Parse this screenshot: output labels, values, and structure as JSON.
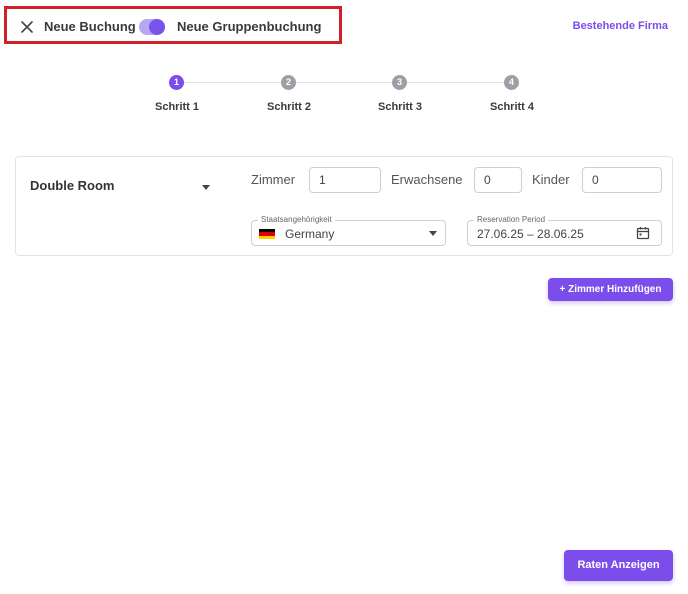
{
  "header": {
    "close_icon": "close-icon",
    "left_label": "Neue Buchung",
    "right_label": "Neue Gruppenbuchung",
    "toggle_on": true,
    "existing_company_link": "Bestehende Firma",
    "highlight_color": "#d0202a"
  },
  "stepper": {
    "steps": [
      {
        "number": "1",
        "label": "Schritt 1",
        "active": true
      },
      {
        "number": "2",
        "label": "Schritt 2",
        "active": false
      },
      {
        "number": "3",
        "label": "Schritt 3",
        "active": false
      },
      {
        "number": "4",
        "label": "Schritt 4",
        "active": false
      }
    ],
    "active_color": "#7b4dea",
    "inactive_color": "#9aa0a6"
  },
  "room": {
    "type": "Double Room",
    "rooms_label": "Zimmer",
    "rooms_value": "1",
    "adults_label": "Erwachsene",
    "adults_value": "0",
    "children_label": "Kinder",
    "children_value": "0",
    "nationality_label": "Staatsangehörigkeit",
    "nationality_value": "Germany",
    "period_label": "Reservation Period",
    "period_value": "27.06.25 – 28.06.25"
  },
  "actions": {
    "add_room": "+ Zimmer Hinzufügen",
    "show_rates": "Raten Anzeigen"
  },
  "accent_color": "#7b4dea"
}
